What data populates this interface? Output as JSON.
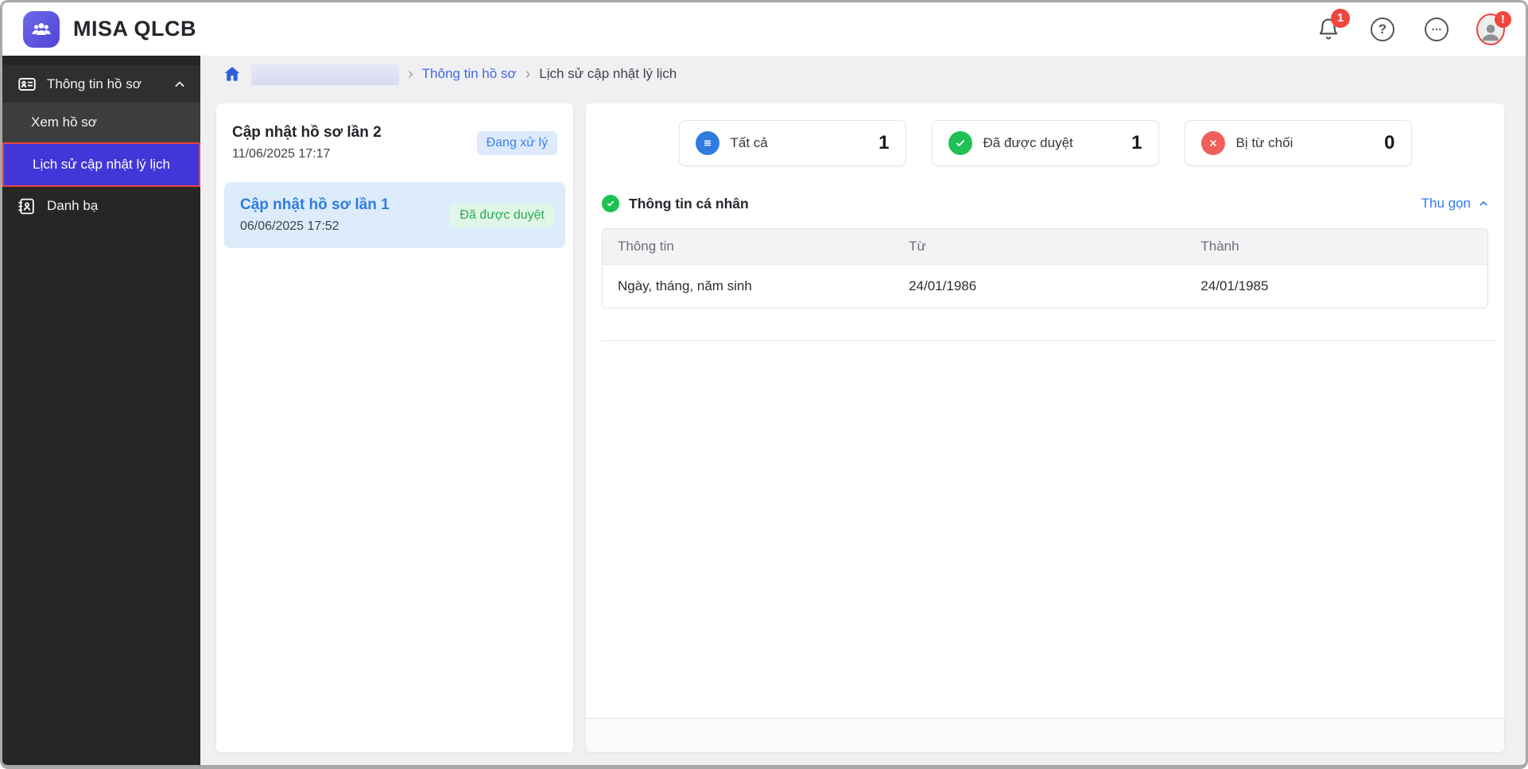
{
  "header": {
    "brand": "MISA QLCB",
    "notification_count": "1",
    "avatar_alert": "!",
    "help_glyph": "?"
  },
  "sidebar": {
    "items": [
      {
        "label": "Thông tin hồ sơ"
      },
      {
        "label": "Xem hồ sơ"
      },
      {
        "label": "Lịch sử cập nhật lý lịch"
      },
      {
        "label": "Danh bạ"
      }
    ]
  },
  "breadcrumb": {
    "separator": "›",
    "crumb_profile": "Thông tin hồ sơ",
    "crumb_current": "Lịch sử cập nhật lý lịch"
  },
  "history": {
    "items": [
      {
        "title": "Cập nhật hồ sơ lần 2",
        "date": "11/06/2025 17:17",
        "status": "Đang xử lý"
      },
      {
        "title": "Cập nhật hồ sơ lần 1",
        "date": "06/06/2025 17:52",
        "status": "Đã được duyệt"
      }
    ]
  },
  "stats": [
    {
      "label": "Tất cả",
      "value": "1",
      "color": "#2e7ce0"
    },
    {
      "label": "Đã được duyệt",
      "value": "1",
      "color": "#1fc155"
    },
    {
      "label": "Bị từ chối",
      "value": "0",
      "color": "#f15f5c"
    }
  ],
  "detail": {
    "section_title": "Thông tin cá nhân",
    "collapse_label": "Thu gọn",
    "table": {
      "headers": [
        "Thông tin",
        "Từ",
        "Thành"
      ],
      "rows": [
        [
          "Ngày, tháng, năm sinh",
          "24/01/1986",
          "24/01/1985"
        ]
      ]
    }
  },
  "colors": {
    "active_nav_bg": "#4236d9",
    "annotation_red": "#e8453b",
    "status_processing_text": "#3e82ec",
    "status_approved_text": "#2bab53"
  }
}
